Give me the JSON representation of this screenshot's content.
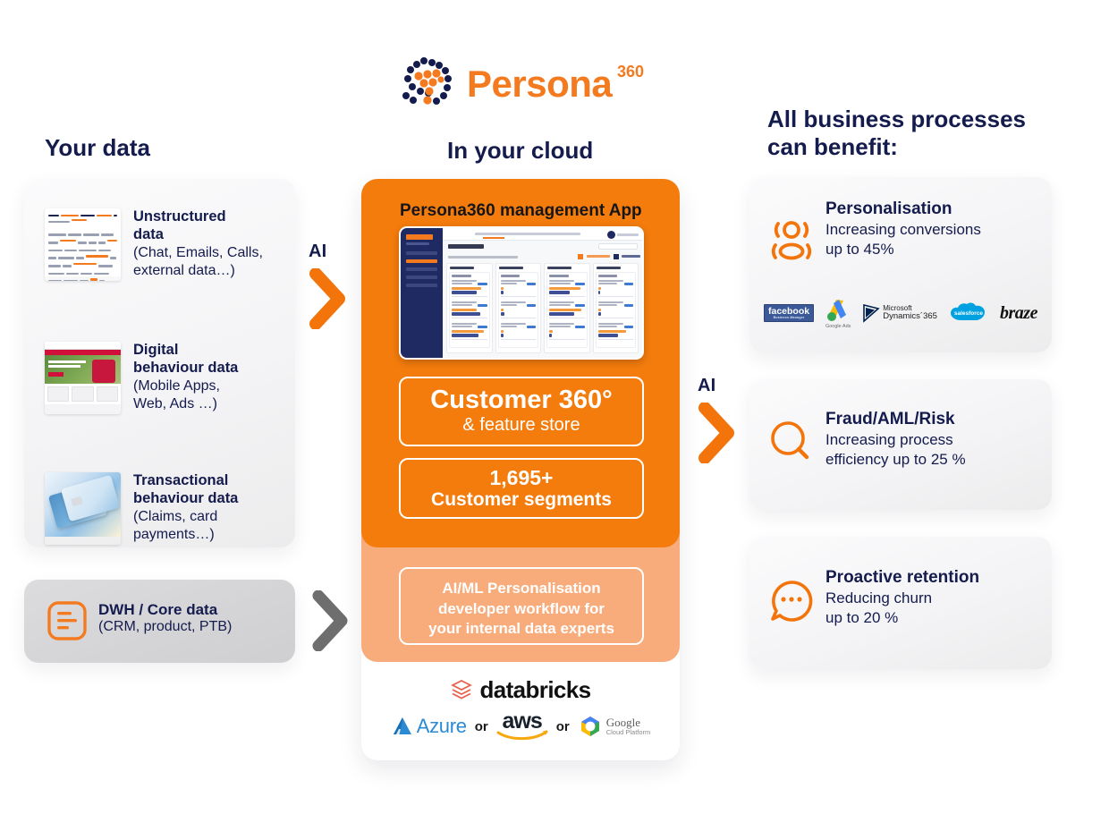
{
  "logo": {
    "word": "Persona",
    "superscript": "360",
    "mark_icon": "persona-dots-logo"
  },
  "headings": {
    "left": "Your data",
    "middle": "In your cloud",
    "right_line1": "All business processes",
    "right_line2": "can benefit:"
  },
  "colors": {
    "navy": "#141b4d",
    "orange": "#f47c0c",
    "orange_light": "#f8ac7b",
    "grey_card": "#d6d6d8"
  },
  "left": {
    "sources": [
      {
        "title": "Unstructured\ndata",
        "subtitle": "(Chat, Emails, Calls,\nexternal data…)",
        "thumb": "document-highlighted-thumbnail"
      },
      {
        "title": "Digital\nbehaviour data",
        "subtitle": "(Mobile Apps,\nWeb, Ads …)",
        "thumb": "website-screenshot-thumbnail"
      },
      {
        "title": "Transactional\nbehaviour data",
        "subtitle": "(Claims, card\npayments…)",
        "thumb": "credit-cards-thumbnail"
      }
    ],
    "dwh": {
      "title": "DWH / Core data",
      "subtitle": "(CRM, product, PTB)",
      "icon": "document-list-icon"
    }
  },
  "arrows": {
    "ai_left_label": "AI",
    "ai_right_label": "AI",
    "grey_chevron_icon": "chevron-right-icon"
  },
  "center": {
    "app_title": "Persona360 management App",
    "app_screenshot_alt": "persona360-dashboard-screenshot",
    "customer360": {
      "title": "Customer 360°",
      "subtitle": "& feature store"
    },
    "segments": {
      "number": "1,695+",
      "label": "Customer segments"
    },
    "aiml": {
      "line1": "AI/ML Personalisation",
      "line2": "developer workflow for",
      "line3": "your internal data experts"
    },
    "platform": {
      "name": "databricks",
      "icon": "databricks-logo"
    },
    "clouds": [
      {
        "name": "Azure",
        "icon": "azure-logo"
      },
      {
        "name": "aws",
        "icon": "aws-logo"
      },
      {
        "name": "Google Cloud Platform",
        "icon": "gcp-logo",
        "line1": "Google",
        "line2": "Cloud Platform"
      }
    ],
    "cloud_separator": "or"
  },
  "right": {
    "benefits": [
      {
        "title": "Personalisation",
        "sub_line1": "Increasing conversions",
        "sub_line2": "up to 45%",
        "icon": "people-group-icon",
        "partners": [
          {
            "name": "facebook",
            "caption": "Business Manager",
            "icon": "facebook-logo"
          },
          {
            "name": "Google Ads",
            "icon": "google-ads-logo"
          },
          {
            "name": "Microsoft Dynamics 365",
            "line1": "Microsoft",
            "line2": "Dynamics´365",
            "icon": "microsoft-dynamics-logo"
          },
          {
            "name": "salesforce",
            "icon": "salesforce-logo"
          },
          {
            "name": "braze",
            "icon": "braze-logo"
          }
        ]
      },
      {
        "title": "Fraud/AML/Risk",
        "sub_line1": "Increasing process",
        "sub_line2": "efficiency up to 25 %",
        "icon": "magnifier-icon"
      },
      {
        "title": "Proactive retention",
        "sub_line1": "Reducing churn",
        "sub_line2": "up to 20 %",
        "icon": "chat-bubble-icon"
      }
    ]
  }
}
